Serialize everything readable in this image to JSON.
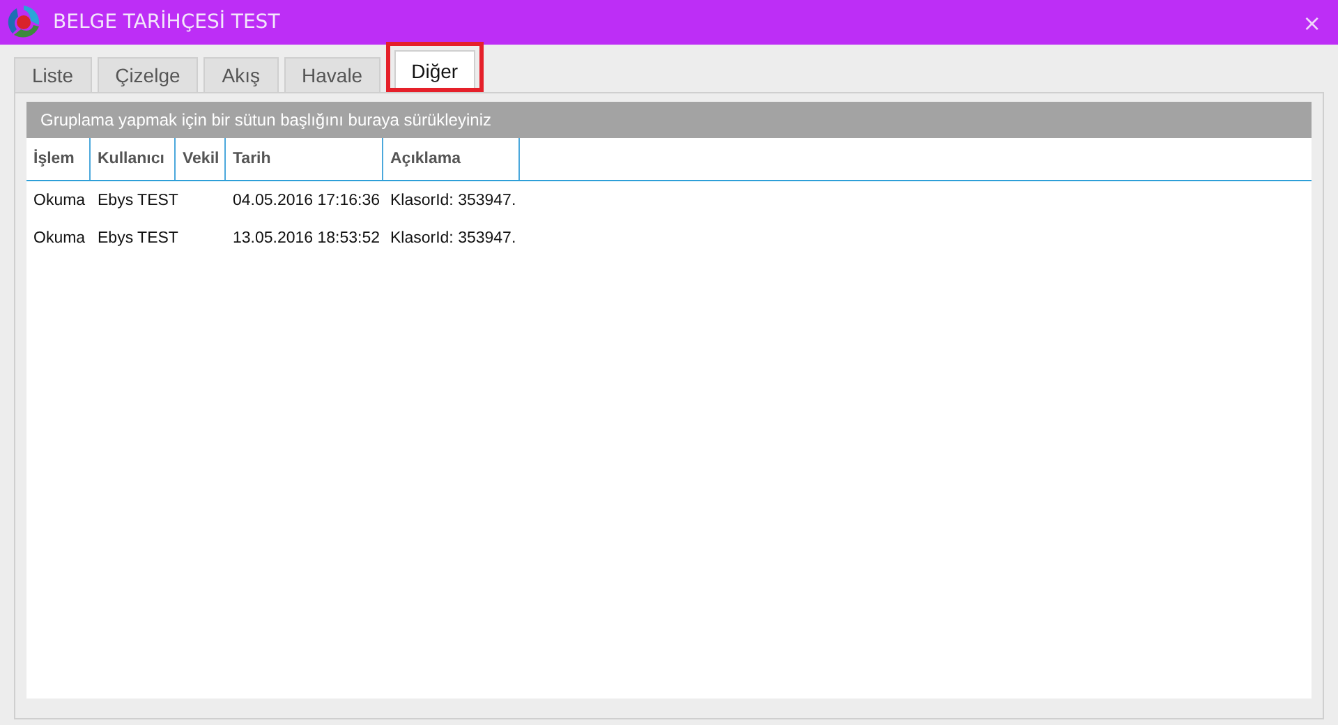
{
  "window": {
    "title": "BELGE TARİHÇESİ TEST",
    "close": "×"
  },
  "tabs": [
    {
      "label": "Liste",
      "selected": false,
      "highlighted": false
    },
    {
      "label": "Çizelge",
      "selected": false,
      "highlighted": false
    },
    {
      "label": "Akış",
      "selected": false,
      "highlighted": false
    },
    {
      "label": "Havale",
      "selected": false,
      "highlighted": false
    },
    {
      "label": "Diğer",
      "selected": true,
      "highlighted": true
    }
  ],
  "group_bar": {
    "text": "Gruplama yapmak için bir sütun başlığını buraya sürükleyiniz"
  },
  "table": {
    "columns": [
      "İşlem",
      "Kullanıcı",
      "Vekil",
      "Tarih",
      "Açıklama"
    ],
    "rows": [
      [
        "Okuma",
        "Ebys TEST",
        "",
        "04.05.2016 17:16:36",
        "KlasorId: 353947."
      ],
      [
        "Okuma",
        "Ebys TEST",
        "",
        "13.05.2016 18:53:52",
        "KlasorId: 353947."
      ]
    ]
  }
}
